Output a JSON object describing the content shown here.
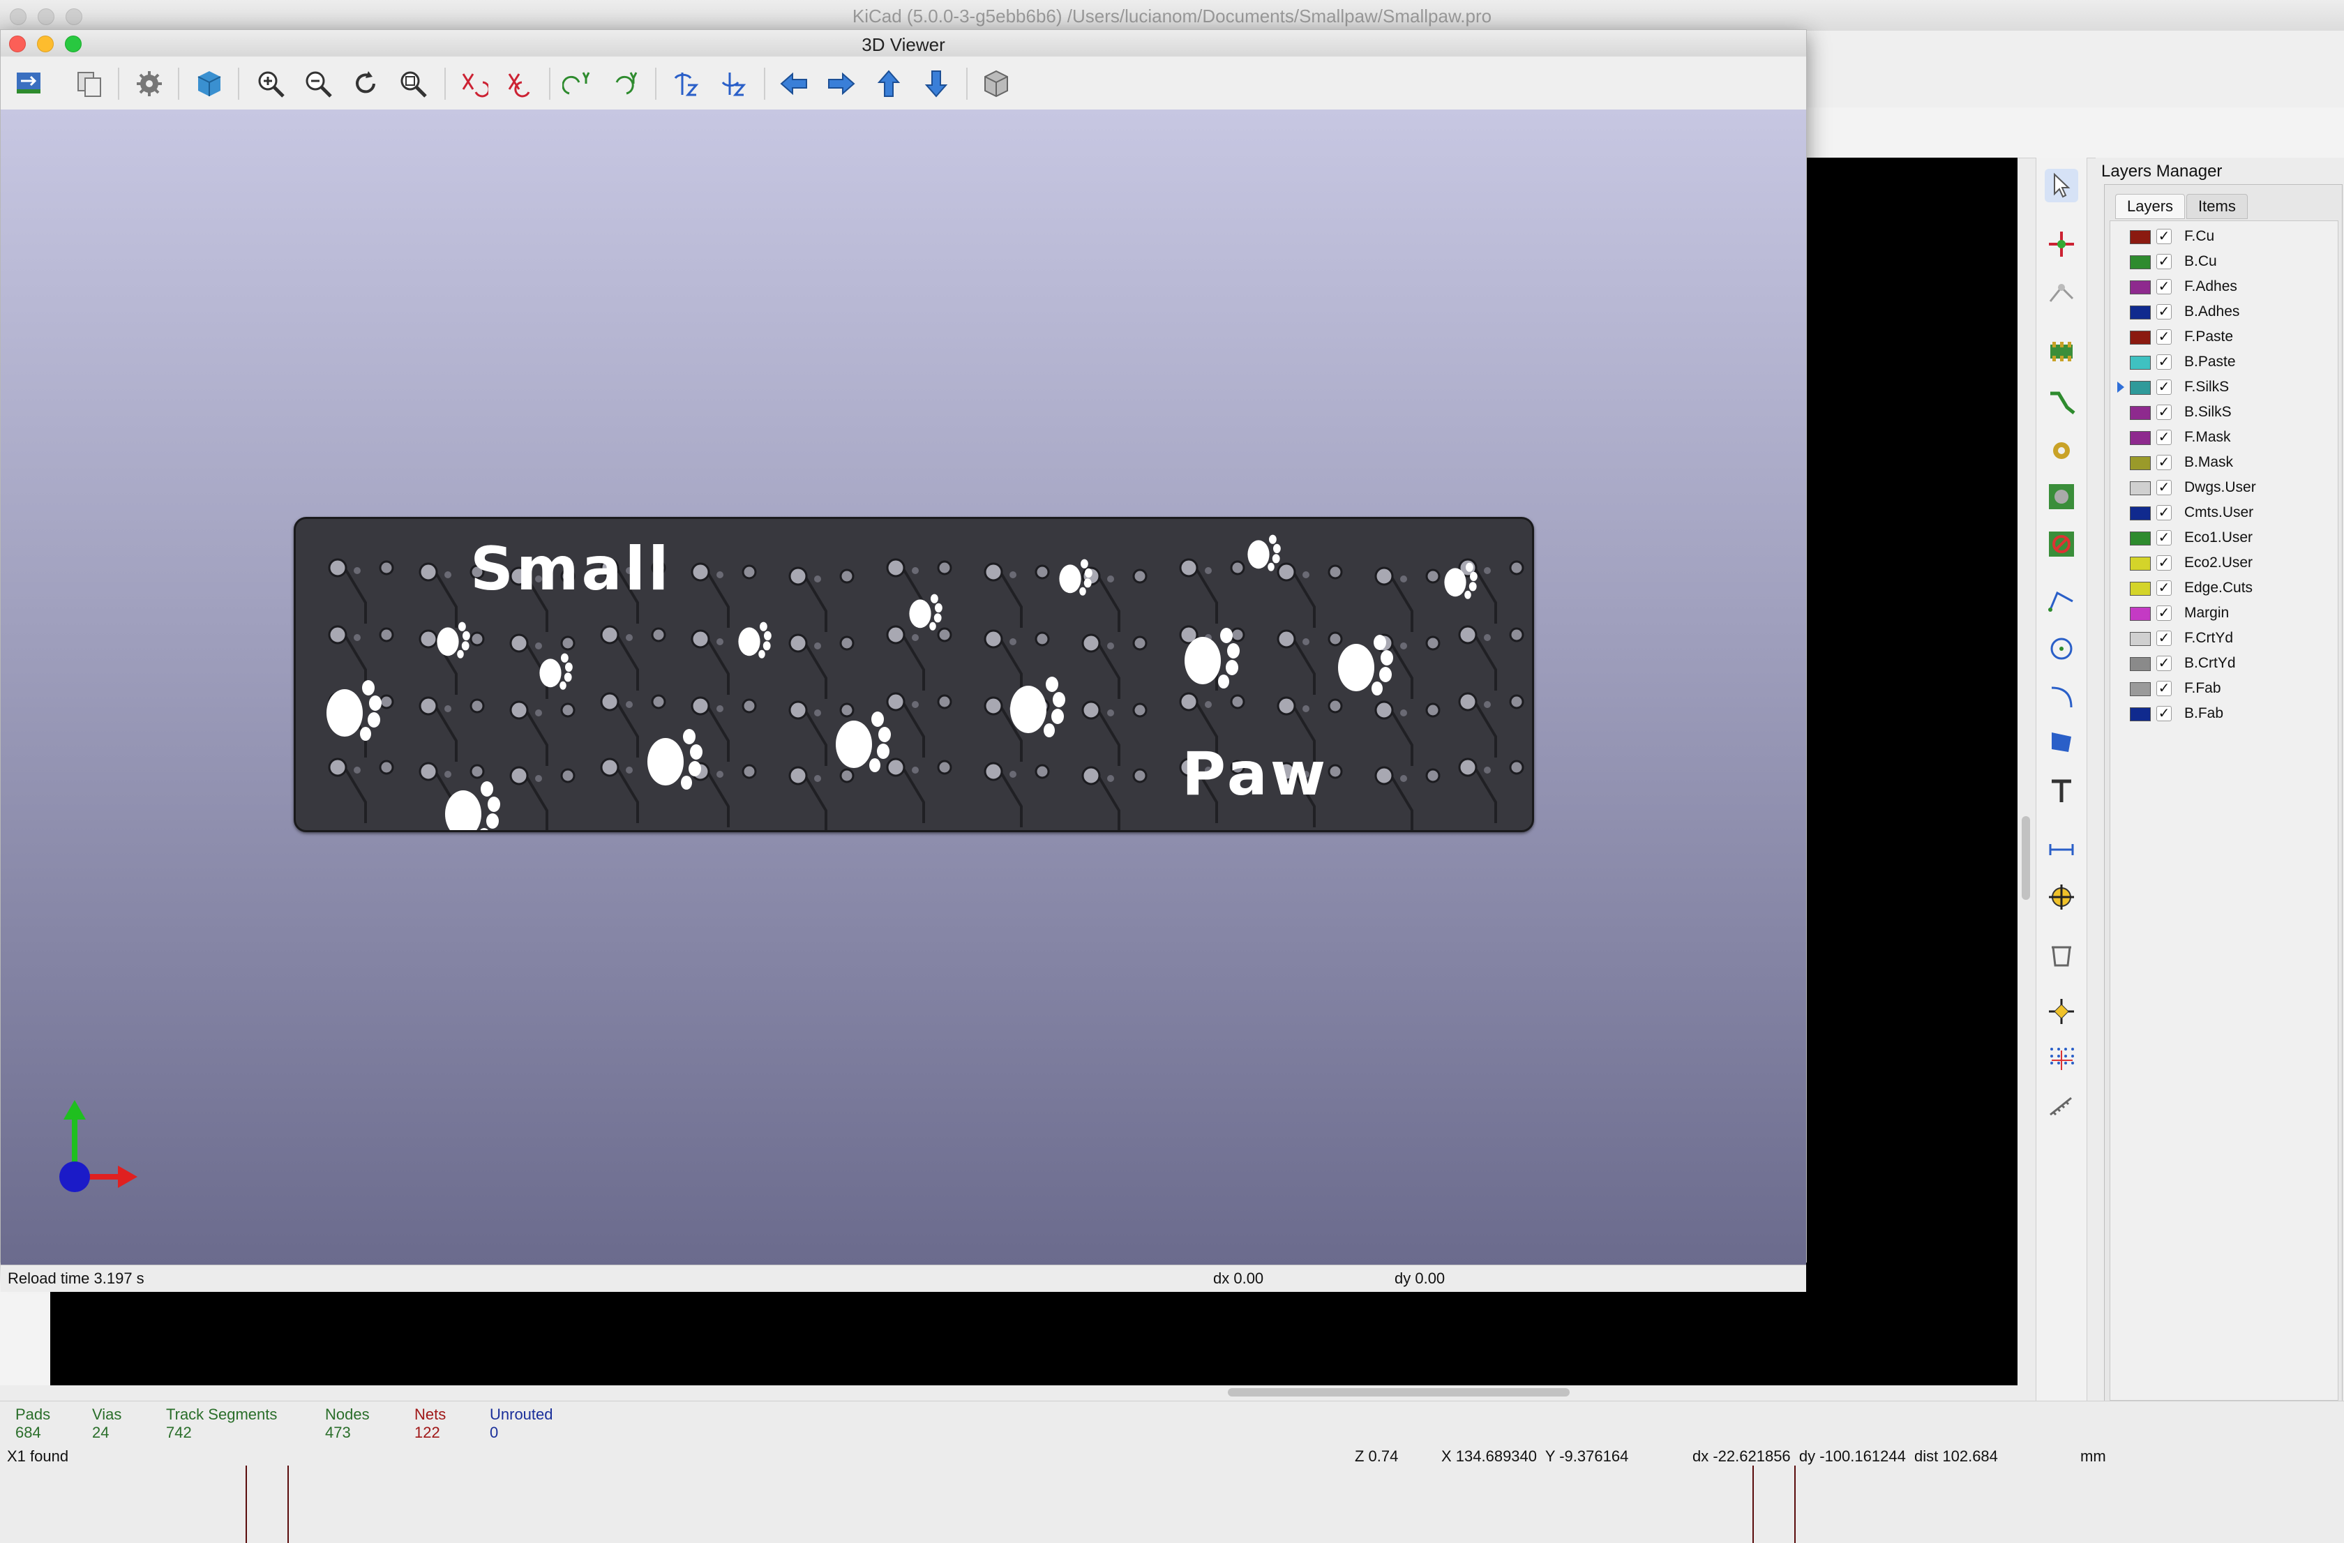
{
  "app": {
    "title": "KiCad (5.0.0-3-g5ebb6b6) /Users/lucianom/Documents/Smallpaw/Smallpaw.pro"
  },
  "viewer": {
    "title": "3D Viewer",
    "toolbar": [
      "reload-board-icon",
      "copy-icon",
      "settings-icon",
      "raytrace-icon",
      "zoom-in-icon",
      "zoom-out-icon",
      "redraw-icon",
      "zoom-fit-icon",
      "rotate-x-cw-icon",
      "rotate-x-ccw-icon",
      "rotate-y-cw-icon",
      "rotate-y-ccw-icon",
      "rotate-z-cw-icon",
      "rotate-z-ccw-icon",
      "move-left-icon",
      "move-right-icon",
      "move-up-icon",
      "move-down-icon",
      "ortho-icon"
    ],
    "board_text": {
      "line1": "Small",
      "line2": "Paw"
    },
    "status": {
      "reload": "Reload time 3.197 s",
      "dx": "dx 0.00",
      "dy": "dy 0.00"
    }
  },
  "layers_manager": {
    "title": "Layers Manager",
    "tabs": [
      "Layers",
      "Items"
    ],
    "layers": [
      {
        "name": "F.Cu",
        "color": "#8b1a10",
        "checked": "✓"
      },
      {
        "name": "B.Cu",
        "color": "#2e8b2e",
        "checked": "✓"
      },
      {
        "name": "F.Adhes",
        "color": "#8e2a8e",
        "checked": "✓"
      },
      {
        "name": "B.Adhes",
        "color": "#102a8e",
        "checked": "✓"
      },
      {
        "name": "F.Paste",
        "color": "#8b1a10",
        "checked": "✓"
      },
      {
        "name": "B.Paste",
        "color": "#3fc1c1",
        "checked": "✓"
      },
      {
        "name": "F.SilkS",
        "color": "#2f9a9a",
        "checked": "✓",
        "selected": true
      },
      {
        "name": "B.SilkS",
        "color": "#8e2a8e",
        "checked": "✓"
      },
      {
        "name": "F.Mask",
        "color": "#8e2a8e",
        "checked": "✓"
      },
      {
        "name": "B.Mask",
        "color": "#9a9a2a",
        "checked": "✓"
      },
      {
        "name": "Dwgs.User",
        "color": "#d0d0d0",
        "checked": "✓"
      },
      {
        "name": "Cmts.User",
        "color": "#102a8e",
        "checked": "✓"
      },
      {
        "name": "Eco1.User",
        "color": "#2e8b2e",
        "checked": "✓"
      },
      {
        "name": "Eco2.User",
        "color": "#d4d42a",
        "checked": "✓"
      },
      {
        "name": "Edge.Cuts",
        "color": "#d4d42a",
        "checked": "✓"
      },
      {
        "name": "Margin",
        "color": "#c43ac4",
        "checked": "✓"
      },
      {
        "name": "F.CrtYd",
        "color": "#d0d0d0",
        "checked": "✓"
      },
      {
        "name": "B.CrtYd",
        "color": "#8a8a8a",
        "checked": "✓"
      },
      {
        "name": "F.Fab",
        "color": "#9a9a9a",
        "checked": "✓"
      },
      {
        "name": "B.Fab",
        "color": "#102a8e",
        "checked": "✓"
      }
    ]
  },
  "stats": {
    "pads": {
      "label": "Pads",
      "value": "684"
    },
    "vias": {
      "label": "Vias",
      "value": "24"
    },
    "tracks": {
      "label": "Track Segments",
      "value": "742"
    },
    "nodes": {
      "label": "Nodes",
      "value": "473"
    },
    "nets": {
      "label": "Nets",
      "value": "122"
    },
    "unrouted": {
      "label": "Unrouted",
      "value": "0"
    }
  },
  "status": {
    "message": "X1 found",
    "zoom": "Z 0.74",
    "xy": "X 134.689340  Y -9.376164",
    "delta": "dx -22.621856  dy -100.161244  dist 102.684",
    "units": "mm"
  },
  "right_tools": [
    "select-arrow-icon",
    "highlight-net-icon",
    "local-ratsnest-icon",
    "add-footprint-icon",
    "route-track-icon",
    "add-via-icon",
    "add-zone-icon",
    "keepout-icon",
    "add-line-icon",
    "add-circle-icon",
    "add-arc-icon",
    "add-polygon-icon",
    "add-text-icon",
    "add-dimension-icon",
    "add-target-icon",
    "delete-icon",
    "set-origin-icon",
    "grid-origin-icon",
    "measure-icon"
  ]
}
